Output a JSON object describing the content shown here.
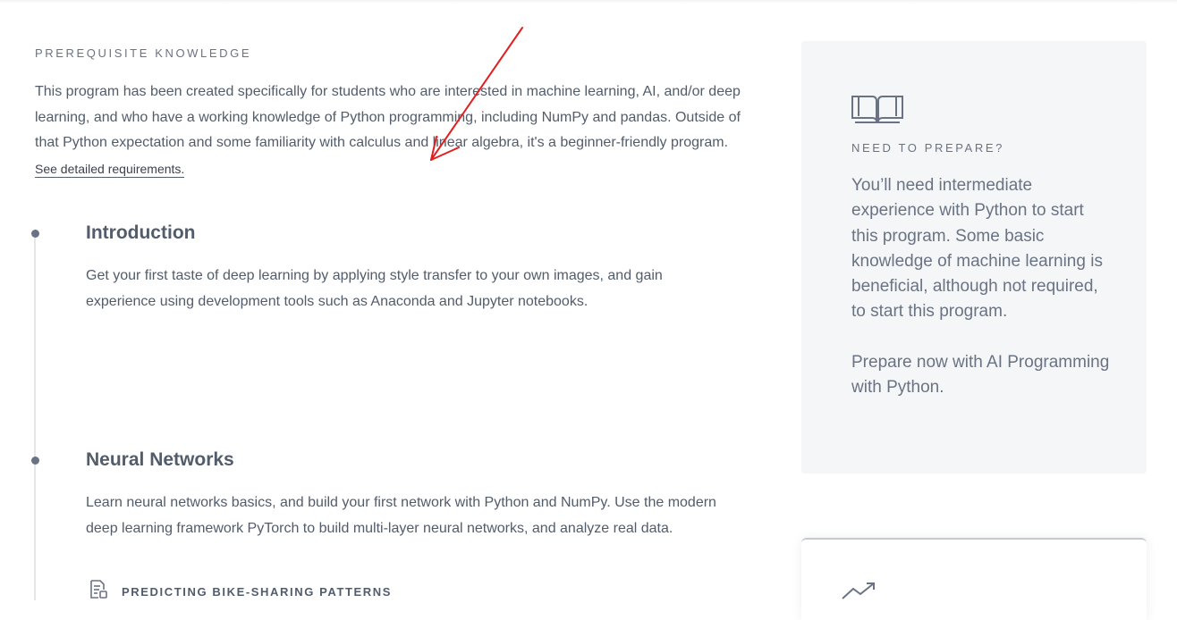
{
  "prerequisites": {
    "heading": "PREREQUISITE KNOWLEDGE",
    "body": "This program has been created specifically for students who are interested in machine learning, AI, and/or deep learning, and who have a working knowledge of Python programming, including NumPy and pandas. Outside of that Python expectation and some familiarity with calculus and linear algebra, it's a beginner-friendly program.",
    "link_label": "See detailed requirements."
  },
  "lessons": [
    {
      "title": "Introduction",
      "description": "Get your first taste of deep learning by applying style transfer to your own images, and gain experience using development tools such as Anaconda and Jupyter notebooks."
    },
    {
      "title": "Neural Networks",
      "description": "Learn neural networks basics, and build your first network with Python and NumPy. Use the modern deep learning framework PyTorch to build multi-layer neural networks, and analyze real data.",
      "project": {
        "label": "PREDICTING BIKE-SHARING PATTERNS",
        "icon": "project-document-icon"
      }
    }
  ],
  "prepare_card": {
    "icon": "open-book-icon",
    "heading": "NEED TO PREPARE?",
    "paragraph1": "You’ll need intermediate experience with Python to start this program. Some basic knowledge of machine learning is beneficial, although not required, to start this program.",
    "paragraph2": "Prepare now with AI Programming with Python."
  },
  "second_card": {
    "icon": "trending-up-icon"
  },
  "colors": {
    "text": "#525c6b",
    "muted": "#6a7384",
    "card_bg": "#f5f6f8",
    "annotation_arrow": "#e02020"
  }
}
